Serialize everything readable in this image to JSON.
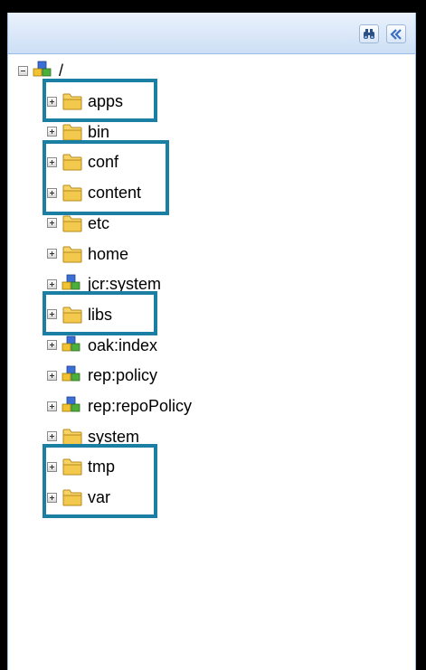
{
  "toolbar": {
    "search_icon": "binoculars-icon",
    "collapse_icon": "double-chevron-left-icon",
    "accent": "#3a6fc4"
  },
  "tree": {
    "root_label": "/",
    "nodes": [
      {
        "label": "apps",
        "type": "folder",
        "highlight_group": 1
      },
      {
        "label": "bin",
        "type": "folder"
      },
      {
        "label": "conf",
        "type": "folder",
        "highlight_group": 2
      },
      {
        "label": "content",
        "type": "folder",
        "highlight_group": 2
      },
      {
        "label": "etc",
        "type": "folder"
      },
      {
        "label": "home",
        "type": "folder"
      },
      {
        "label": "jcr:system",
        "type": "node"
      },
      {
        "label": "libs",
        "type": "folder",
        "highlight_group": 3
      },
      {
        "label": "oak:index",
        "type": "node"
      },
      {
        "label": "rep:policy",
        "type": "node"
      },
      {
        "label": "rep:repoPolicy",
        "type": "node"
      },
      {
        "label": "system",
        "type": "folder"
      },
      {
        "label": "tmp",
        "type": "folder",
        "highlight_group": 4
      },
      {
        "label": "var",
        "type": "folder",
        "highlight_group": 4
      }
    ]
  },
  "colors": {
    "highlight_box": "#1a7fa3",
    "panel_border": "#99bbe8",
    "folder": "#f2c94c"
  }
}
